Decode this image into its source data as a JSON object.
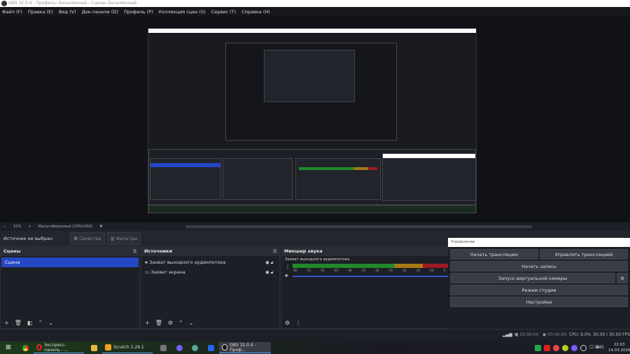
{
  "window": {
    "title": "OBS 32.0.4 - Профиль: Безымянный - Сцены: Безымянный"
  },
  "menu": [
    "Файл (F)",
    "Правка (E)",
    "Вид (V)",
    "Док-панели (D)",
    "Профиль (P)",
    "Коллекция сцен (S)",
    "Сервис (T)",
    "Справка (H)"
  ],
  "zoombar": {
    "minus": "−",
    "zoom": "52%",
    "plus": "+",
    "mode": "Масштабируемый (1002x563)"
  },
  "source_bar": {
    "status": "Источник не выбран",
    "properties": "Свойства",
    "filters": "Фильтры"
  },
  "scenes": {
    "title": "Сцены",
    "items": [
      "Сцена"
    ]
  },
  "sources": {
    "title": "Источники",
    "items": [
      {
        "name": "Захват выходного аудиопотока",
        "icon": "speaker-icon"
      },
      {
        "name": "Захват экрана",
        "icon": "monitor-icon"
      }
    ]
  },
  "mixer": {
    "title": "Микшер звука",
    "channel": "Захват выходного аудиопотока",
    "ticks": [
      "-60",
      "-55",
      "-50",
      "-45",
      "-40",
      "-35",
      "-30",
      "-25",
      "-20",
      "-15",
      "-10",
      "-5",
      "0"
    ],
    "colors": {
      "green": "#1f8a2a",
      "yellow": "#a97a14",
      "red": "#a11a22",
      "volume": "#2f5bd0"
    }
  },
  "controls": {
    "title": "Управление",
    "start_stream": "Начать трансляцию",
    "manage_stream": "Управлять трансляцией",
    "start_record": "Начать запись",
    "virtual_cam": "Запуск виртуальной камеры",
    "studio_mode": "Режим студии",
    "settings": "Настройки"
  },
  "status": {
    "stream_time": "00:00:00",
    "record_time": "00:00:00",
    "cpu": "CPU: 9.0%",
    "fps": "30.00 / 30.00 FPS"
  },
  "taskbar": {
    "apps": [
      "Экспресс-панель - ...",
      "Scratch 3.29.1",
      "OBS 32.0.4 - Проф..."
    ],
    "lang": "ENG",
    "time": "22:03",
    "date": "14.03.2026"
  },
  "accent": "#2447c4"
}
